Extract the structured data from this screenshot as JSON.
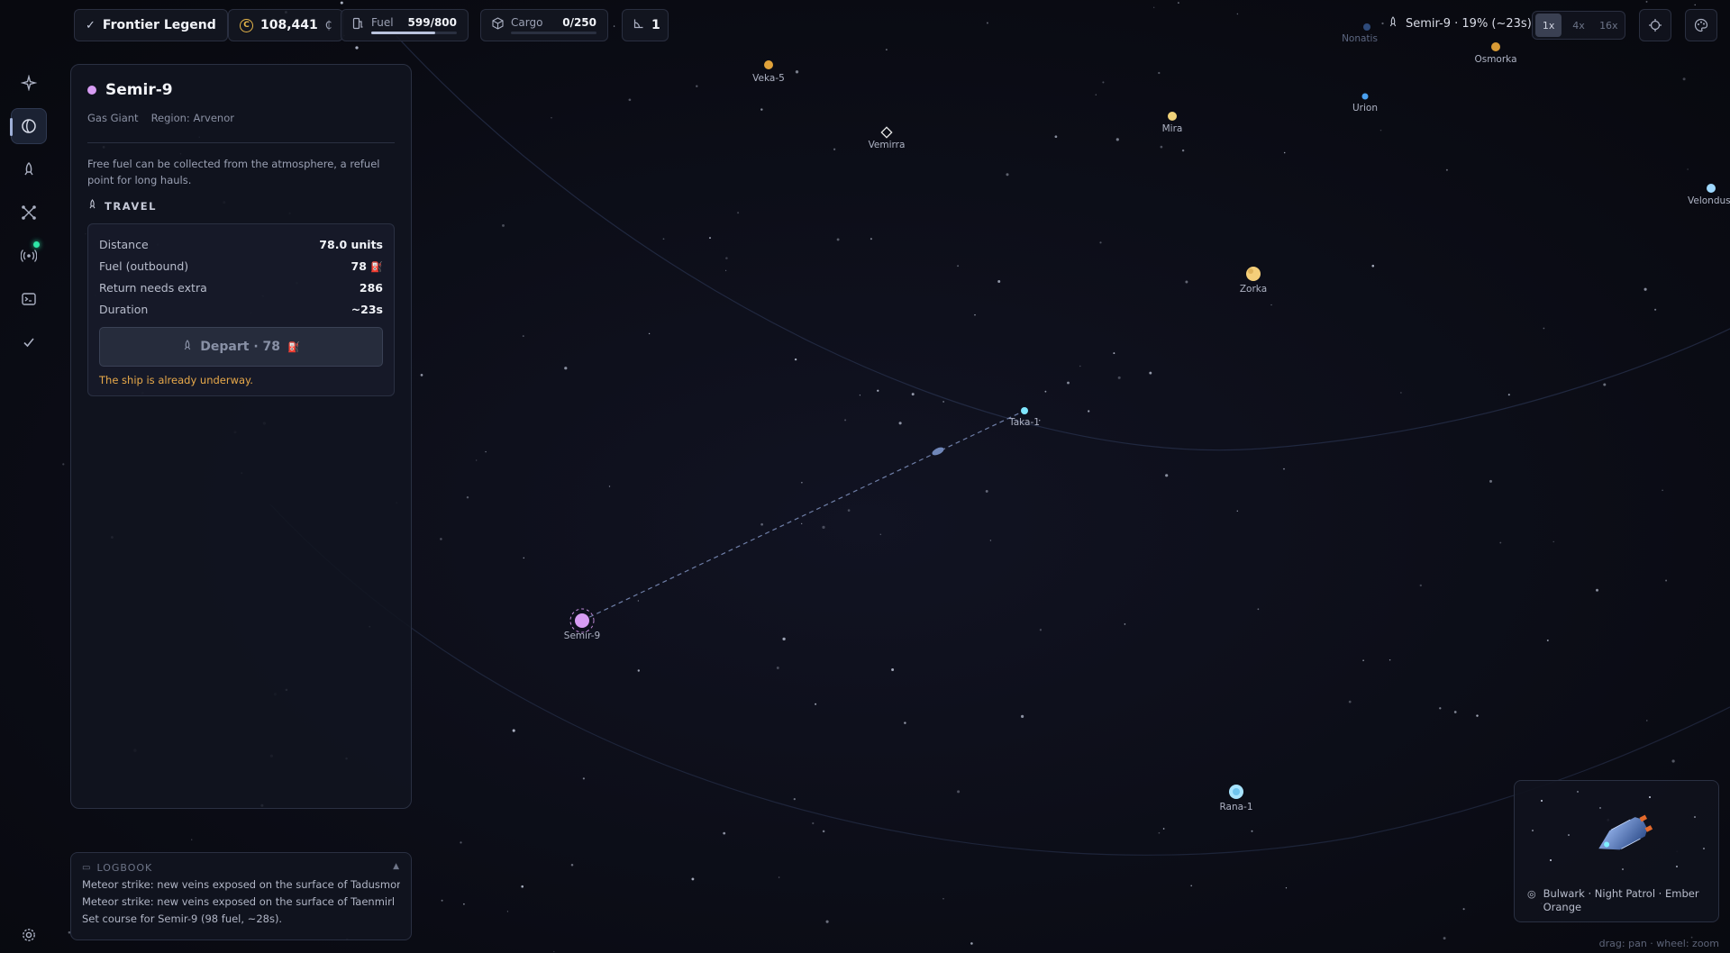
{
  "app": {
    "rank_badge": "Frontier Legend",
    "credits": "108,441",
    "credit_symbol": "₵",
    "fuel_label": "Fuel",
    "fuel_value": "599/800",
    "fuel_fraction": 0.749,
    "cargo_label": "Cargo",
    "cargo_value": "0/250",
    "cargo_fraction": 0.0,
    "level": "1",
    "voyage_status": "Semir-9 · 19% (~23s)",
    "speed_options": [
      "1x",
      "4x",
      "16x"
    ],
    "speed_selected": "1x"
  },
  "rail": {
    "items": [
      {
        "name": "galaxy-icon",
        "active": false
      },
      {
        "name": "planet-icon",
        "active": true
      },
      {
        "name": "rocket-icon",
        "active": false
      },
      {
        "name": "network-icon",
        "active": false
      },
      {
        "name": "signal-icon",
        "active": false,
        "notify": true
      },
      {
        "name": "terminal-icon",
        "active": false
      },
      {
        "name": "check-icon",
        "active": false
      }
    ]
  },
  "planet_panel": {
    "name": "Semir-9",
    "color": "#d79cf3",
    "type": "Gas Giant",
    "region": "Region: Arvenor",
    "description": "Free fuel can be collected from the atmosphere, a refuel point for long hauls.",
    "travel_header": "TRAVEL",
    "stats": [
      {
        "label": "Distance",
        "value": "78.0 units"
      },
      {
        "label": "Fuel (outbound)",
        "value": "78"
      },
      {
        "label": "Return needs extra",
        "value": "286"
      },
      {
        "label": "Duration",
        "value": "~23s"
      }
    ],
    "depart_label": "Depart · 78",
    "warning": "The ship is already underway."
  },
  "logbook": {
    "title": "LOGBOOK",
    "entries": [
      "Meteor strike: new veins exposed on the surface of Tadusmor!",
      "Meteor strike: new veins exposed on the surface of Taenmirl",
      "Set course for Semir-9 (98 fuel, ~28s)."
    ]
  },
  "ship_card": {
    "caption": "Bulwark · Night Patrol · Ember Orange"
  },
  "map": {
    "planets": [
      {
        "name": "Veka-5",
        "color": "#e0a23a"
      },
      {
        "name": "Vemirra",
        "color": "#ffffff"
      },
      {
        "name": "Mira",
        "color": "#f0d27a"
      },
      {
        "name": "Nonatis",
        "color": "#2e4a7a"
      },
      {
        "name": "Osmorka",
        "color": "#d89a35"
      },
      {
        "name": "Urion",
        "color": "#4aa0f0"
      },
      {
        "name": "Velondus-",
        "color": "#9fd8ff"
      },
      {
        "name": "Zorka",
        "color": "#f5cf7a"
      },
      {
        "name": "Taka-1",
        "color": "#7fe6ff"
      },
      {
        "name": "Semir-9",
        "color": "#d79cf3"
      },
      {
        "name": "Rana-1",
        "color": "#a8e4ff"
      }
    ],
    "hint": "drag: pan · wheel: zoom"
  }
}
